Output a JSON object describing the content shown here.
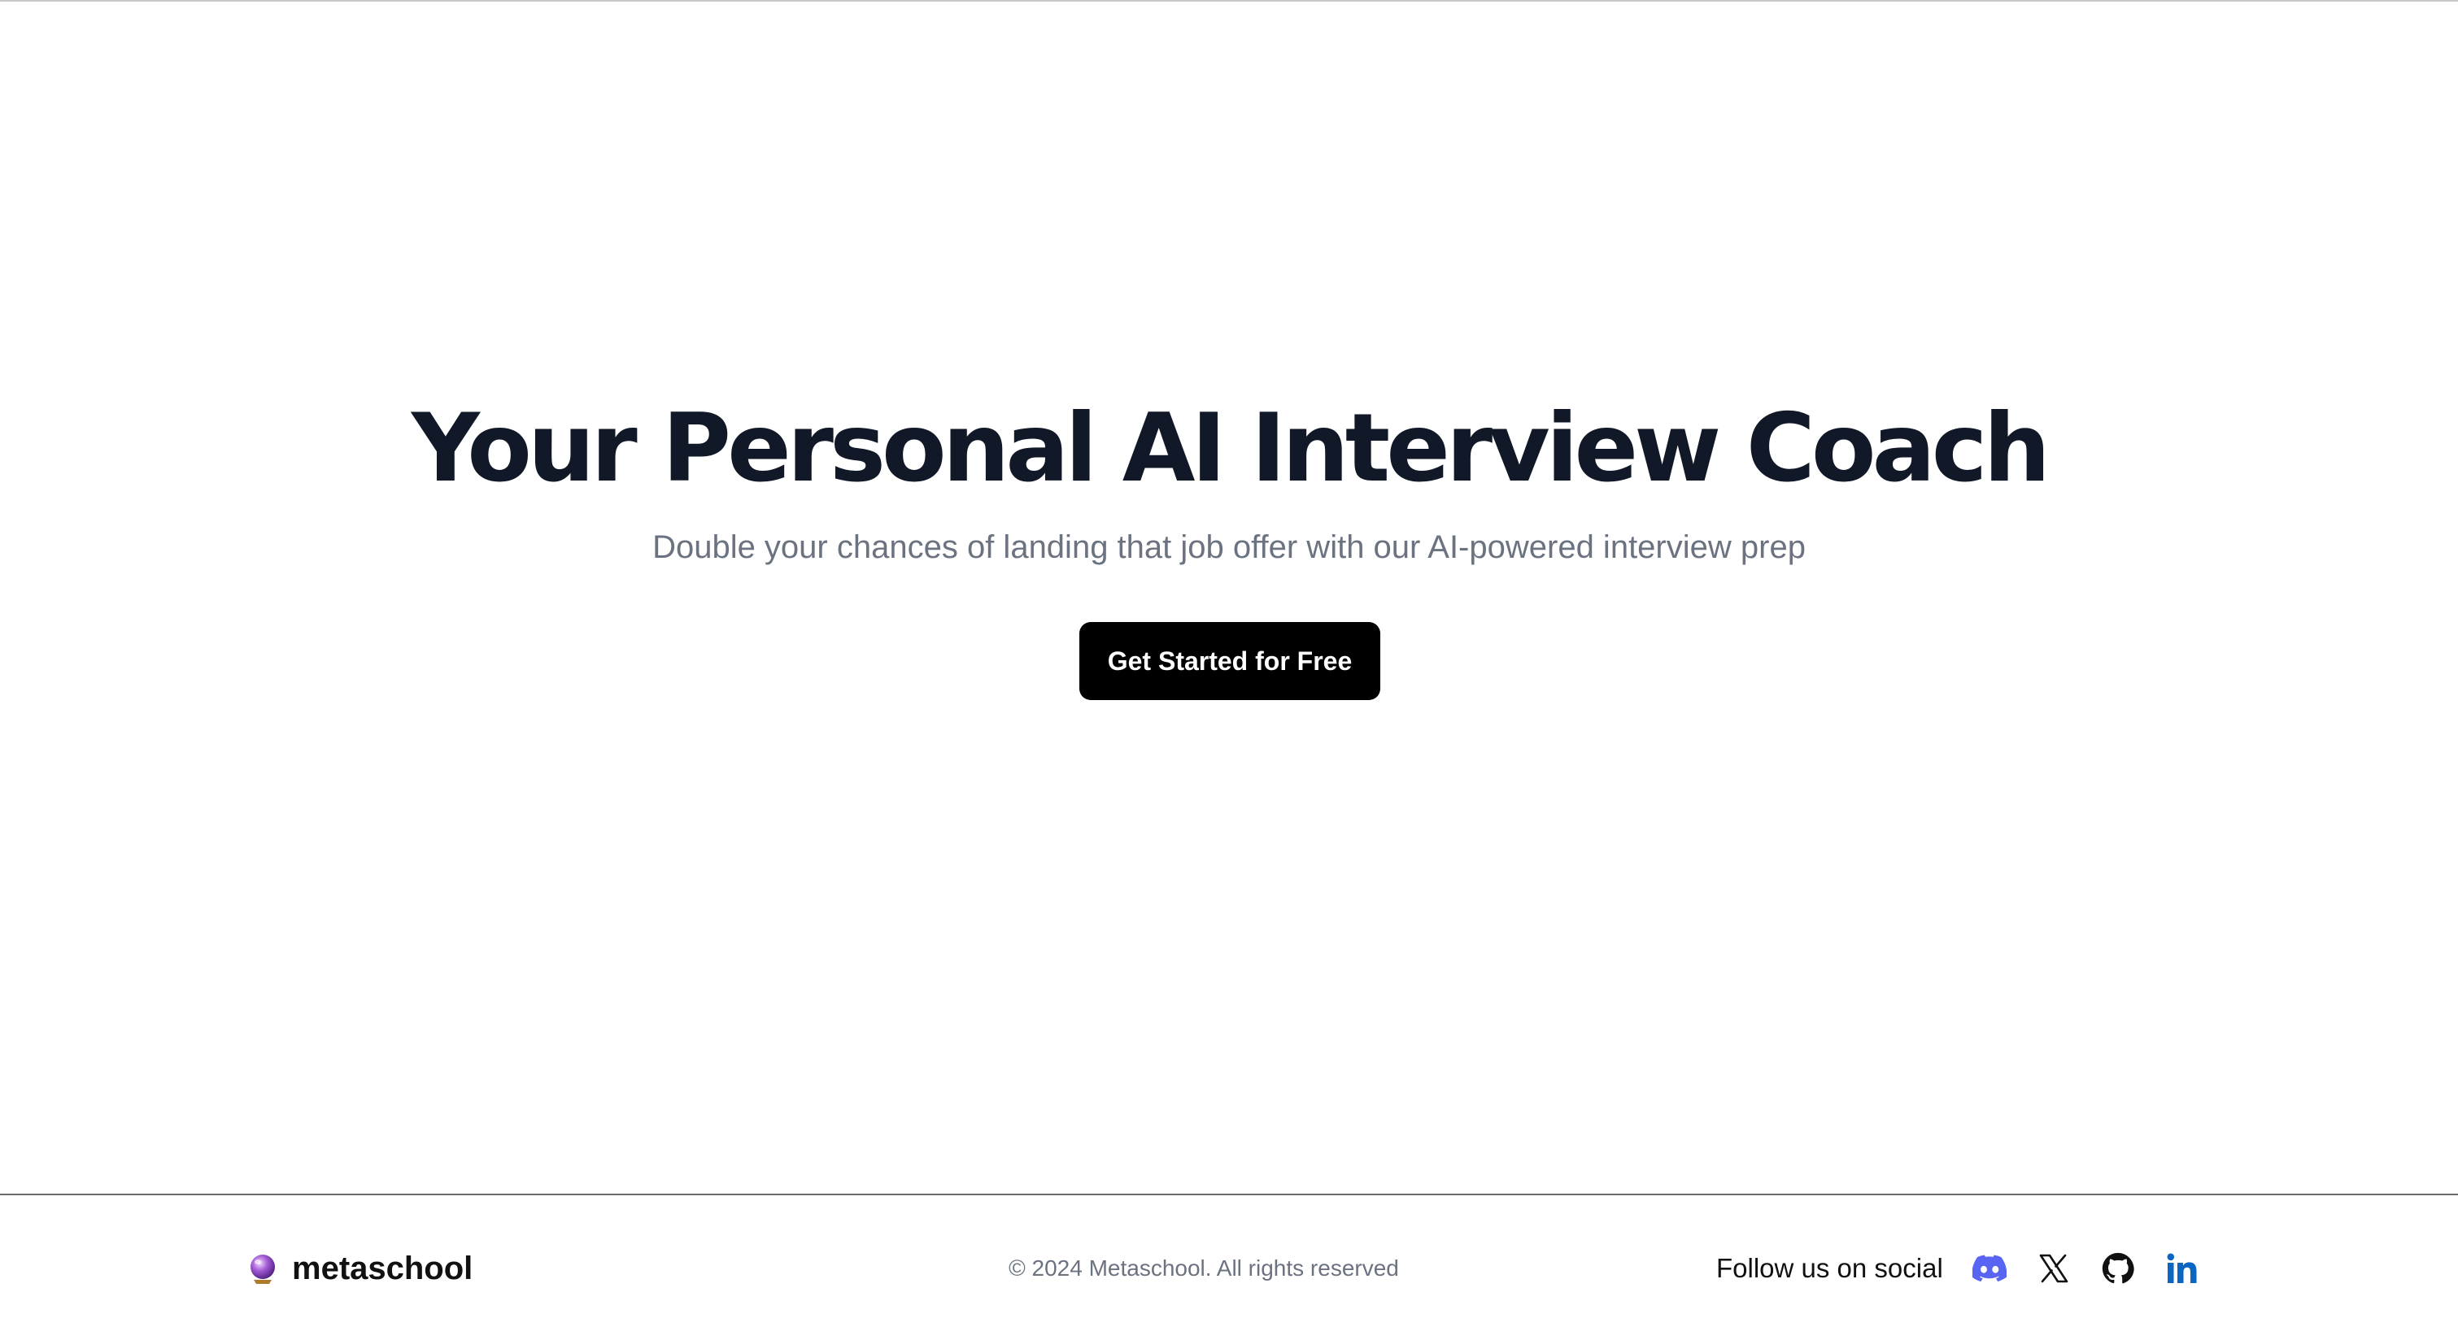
{
  "hero": {
    "title": "Your Personal AI Interview Coach",
    "subtitle": "Double your chances of landing that job offer with our AI-powered interview prep",
    "cta_label": "Get Started for Free"
  },
  "footer": {
    "brand": {
      "name": "metaschool",
      "logo_icon": "crystal-ball-icon"
    },
    "copyright": "© 2024 Metaschool. All rights reserved",
    "social": {
      "label": "Follow us on social",
      "links": [
        {
          "icon": "discord-icon",
          "color": "#5865F2"
        },
        {
          "icon": "x-twitter-icon",
          "color": "#111111"
        },
        {
          "icon": "github-icon",
          "color": "#111111"
        },
        {
          "icon": "linkedin-icon",
          "color": "#0A66C2"
        }
      ]
    }
  },
  "colors": {
    "heading": "#111827",
    "muted_text": "#6b7280",
    "cta_background": "#000000",
    "cta_text": "#ffffff",
    "page_background": "#ffffff"
  }
}
